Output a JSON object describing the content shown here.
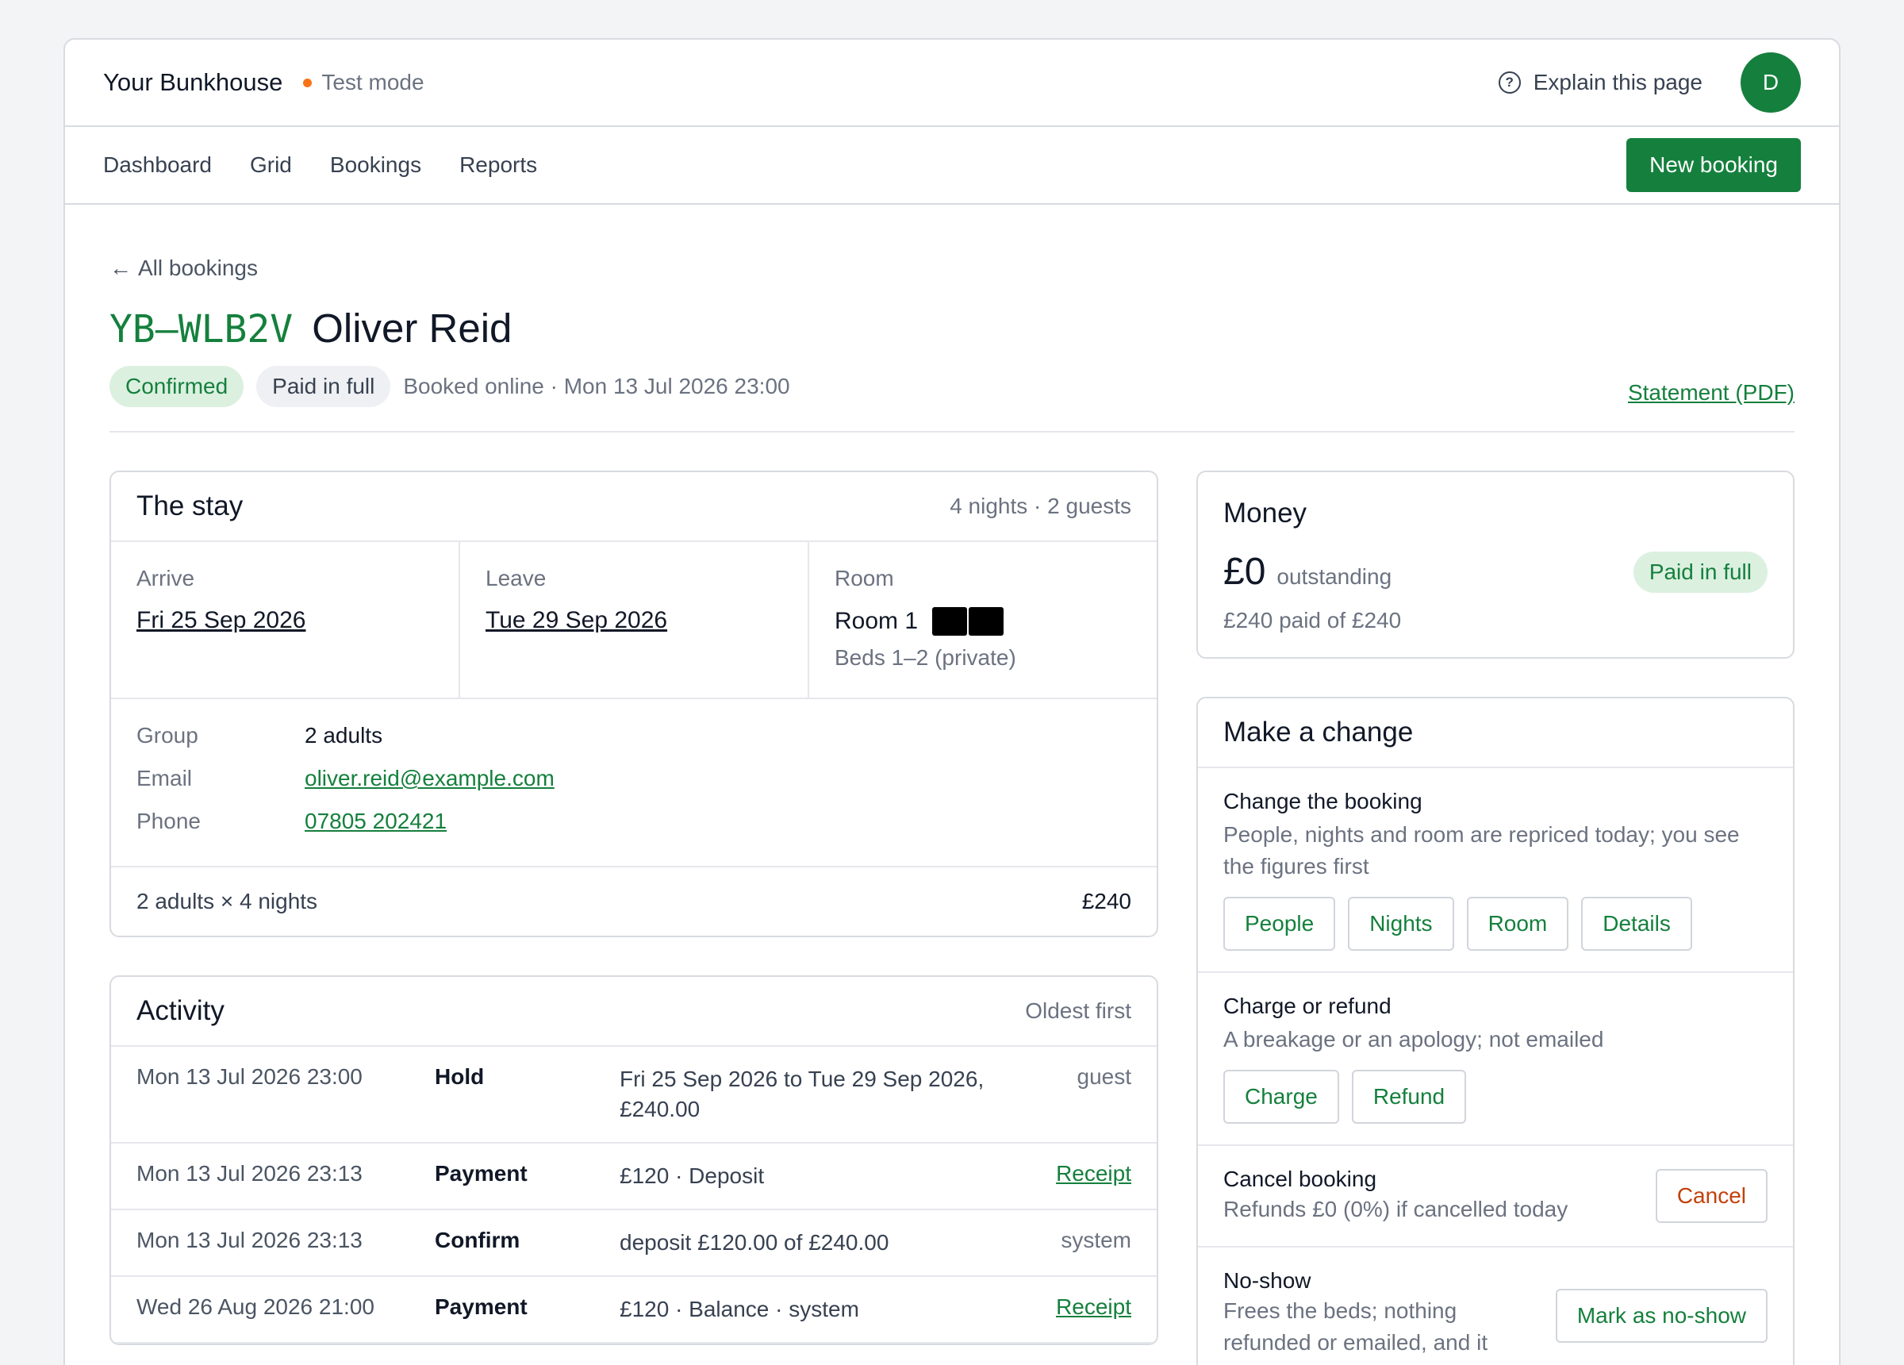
{
  "header": {
    "brand": "Your Bunkhouse",
    "test_mode": "Test mode",
    "explain": "Explain this page",
    "avatar_initial": "D"
  },
  "nav": {
    "items": [
      "Dashboard",
      "Grid",
      "Bookings",
      "Reports"
    ],
    "new_booking": "New booking"
  },
  "booking": {
    "back": "All bookings",
    "reference": "YB–WLB2V",
    "guest_name": "Oliver Reid",
    "status": "Confirmed",
    "payment_status": "Paid in full",
    "booked": "Booked online · Mon 13 Jul 2026 23:00",
    "statement": "Statement (PDF)"
  },
  "stay": {
    "title": "The stay",
    "summary": "4 nights · 2 guests",
    "arrive_label": "Arrive",
    "arrive": "Fri 25 Sep 2026",
    "leave_label": "Leave",
    "leave": "Tue 29 Sep 2026",
    "room_label": "Room",
    "room": "Room 1",
    "beds": "Beds 1–2 (private)",
    "group_label": "Group",
    "group": "2 adults",
    "email_label": "Email",
    "email": "oliver.reid@example.com",
    "phone_label": "Phone",
    "phone": "07805 202421",
    "line_item": "2 adults × 4 nights",
    "line_total": "£240"
  },
  "activity": {
    "title": "Activity",
    "order": "Oldest first",
    "rows": [
      {
        "time": "Mon 13 Jul 2026 23:00",
        "kind": "Hold",
        "desc": "Fri 25 Sep 2026 to Tue 29 Sep 2026, £240.00",
        "who": "guest"
      },
      {
        "time": "Mon 13 Jul 2026 23:13",
        "kind": "Payment",
        "desc": "£120 · Deposit",
        "who": "Receipt"
      },
      {
        "time": "Mon 13 Jul 2026 23:13",
        "kind": "Confirm",
        "desc": "deposit £120.00 of £240.00",
        "who": "system"
      },
      {
        "time": "Wed 26 Aug 2026 21:00",
        "kind": "Payment",
        "desc": "£120 · Balance · system",
        "who": "Receipt"
      }
    ]
  },
  "money": {
    "title": "Money",
    "outstanding_amount": "£0",
    "outstanding_label": "outstanding",
    "status": "Paid in full",
    "paid_summary": "£240 paid of £240"
  },
  "change": {
    "title": "Make a change",
    "change_title": "Change the booking",
    "change_desc": "People, nights and room are repriced today; you see the figures first",
    "change_buttons": [
      "People",
      "Nights",
      "Room",
      "Details"
    ],
    "charge_title": "Charge or refund",
    "charge_desc": "A breakage or an apology; not emailed",
    "charge_buttons": [
      "Charge",
      "Refund"
    ],
    "cancel_title": "Cancel booking",
    "cancel_desc": "Refunds £0 (0%) if cancelled today",
    "cancel_button": "Cancel",
    "noshow_title": "No-show",
    "noshow_desc": "Frees the beds; nothing refunded or emailed, and it",
    "noshow_button": "Mark as no-show"
  },
  "colors": {
    "accent": "#15803d",
    "test_dot": "#f97316",
    "danger": "#c2410c"
  }
}
